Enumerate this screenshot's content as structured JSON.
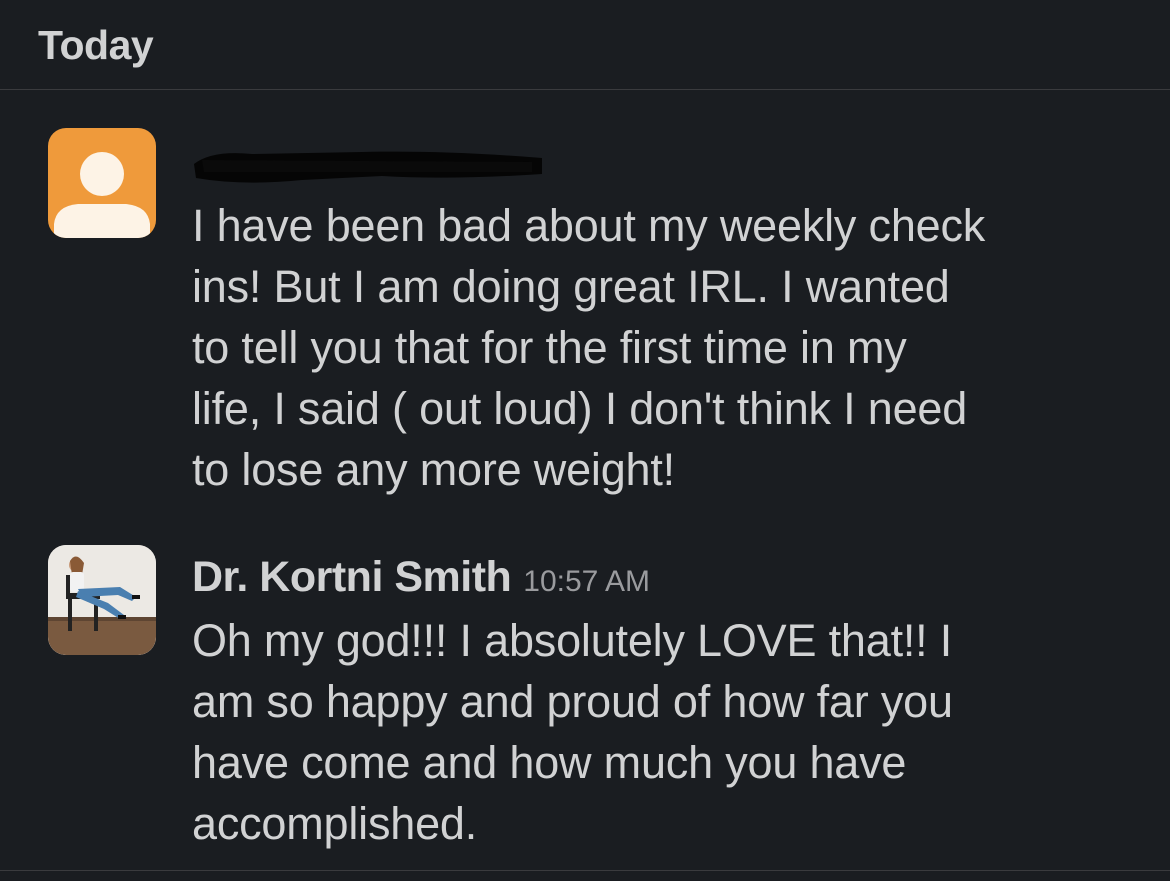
{
  "day_divider": {
    "label": "Today"
  },
  "messages": [
    {
      "sender": "",
      "sender_redacted": true,
      "avatar": "default-user-avatar",
      "avatar_color": "#ef9a3b",
      "text": "I have been bad about my weekly check\nins!  But I am doing great IRL.  I wanted\nto tell you that for the first time in my\nlife, I said ( out loud) I don't think I need\nto lose any more weight!"
    },
    {
      "sender": "Dr. Kortni Smith",
      "timestamp": "10:57 AM",
      "avatar": "profile-photo-avatar",
      "text": "Oh my god!!! I absolutely LOVE that!! I\nam so happy and proud of how far you\nhave come and how much you have\naccomplished."
    }
  ],
  "colors": {
    "background": "#1a1d21",
    "text": "#d1d2d3",
    "timestamp": "#9a9b9e",
    "divider": "#3a3b3e"
  }
}
